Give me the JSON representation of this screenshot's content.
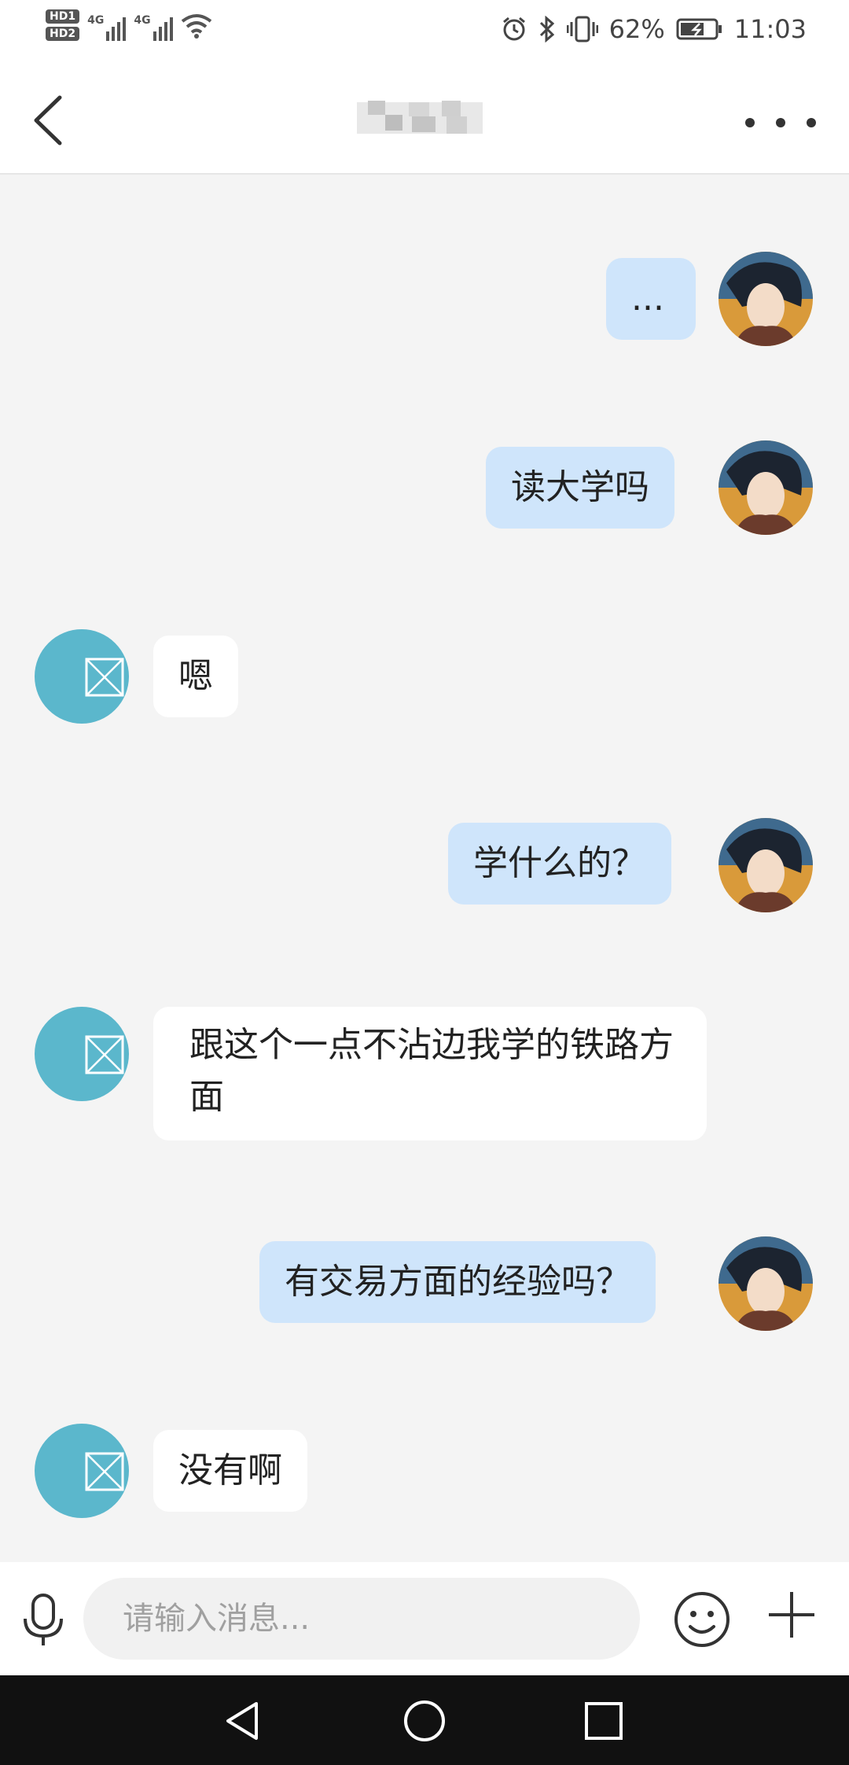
{
  "status_bar": {
    "hd1": "HD1",
    "hd2": "HD2",
    "net1": "4G",
    "net2": "4G",
    "battery_percent": "62%",
    "time": "11:03",
    "icons": [
      "alarm-icon",
      "bluetooth-icon",
      "vibrate-icon",
      "battery-charging-icon",
      "wifi-icon",
      "signal-icon"
    ]
  },
  "header": {
    "back_icon": "chevron-left-icon",
    "more_icon": "more-horizontal-icon"
  },
  "messages": [
    {
      "sender": "me",
      "text": "..."
    },
    {
      "sender": "me",
      "text": "读大学吗"
    },
    {
      "sender": "other",
      "text": "嗯"
    },
    {
      "sender": "me",
      "text": "学什么的？"
    },
    {
      "sender": "other",
      "text": "跟这个一点不沾边我学的铁路方面"
    },
    {
      "sender": "me",
      "text": "有交易方面的经验吗？"
    },
    {
      "sender": "other",
      "text": "没有啊"
    }
  ],
  "input_bar": {
    "placeholder": "请输入消息...",
    "mic_icon": "microphone-icon",
    "emoji_icon": "emoji-icon",
    "plus_icon": "plus-icon"
  },
  "colors": {
    "my_bubble": "#cfe5fb",
    "other_bubble": "#ffffff",
    "other_avatar": "#5bb7cc",
    "background": "#f4f4f4"
  }
}
